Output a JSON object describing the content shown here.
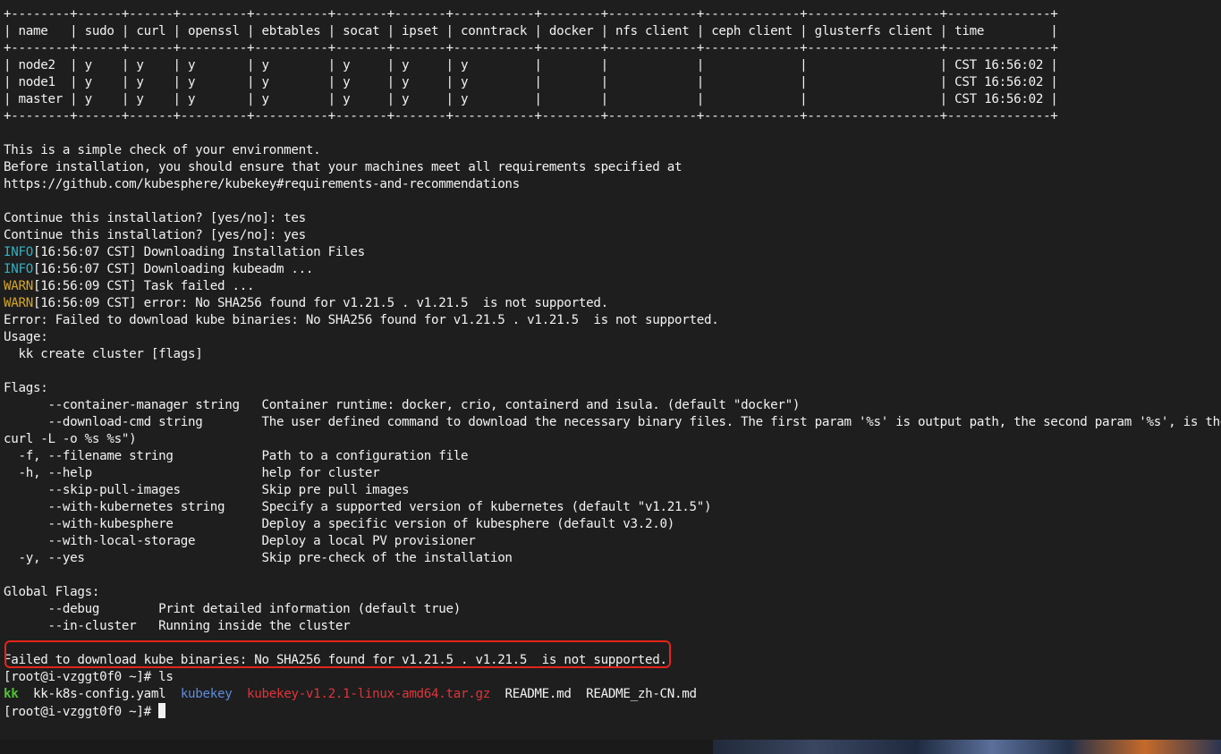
{
  "terminal": {
    "lines": [
      "+--------+------+------+---------+----------+-------+-------+-----------+--------+------------+-------------+------------------+--------------+",
      "| name   | sudo | curl | openssl | ebtables | socat | ipset | conntrack | docker | nfs client | ceph client | glusterfs client | time         |",
      "+--------+------+------+---------+----------+-------+-------+-----------+--------+------------+-------------+------------------+--------------+",
      "| node2  | y    | y    | y       | y        | y     | y     | y         |        |            |             |                  | CST 16:56:02 |",
      "| node1  | y    | y    | y       | y        | y     | y     | y         |        |            |             |                  | CST 16:56:02 |",
      "| master | y    | y    | y       | y        | y     | y     | y         |        |            |             |                  | CST 16:56:02 |",
      "+--------+------+------+---------+----------+-------+-------+-----------+--------+------------+-------------+------------------+--------------+",
      "",
      "This is a simple check of your environment.",
      "Before installation, you should ensure that your machines meet all requirements specified at",
      "https://github.com/kubesphere/kubekey#requirements-and-recommendations",
      "",
      "Continue this installation? [yes/no]: tes",
      "Continue this installation? [yes/no]: yes"
    ],
    "log_lines": [
      {
        "level": "INFO",
        "rest": "[16:56:07 CST] Downloading Installation Files"
      },
      {
        "level": "INFO",
        "rest": "[16:56:07 CST] Downloading kubeadm ..."
      },
      {
        "level": "WARN",
        "rest": "[16:56:09 CST] Task failed ..."
      },
      {
        "level": "WARN",
        "rest": "[16:56:09 CST] error: No SHA256 found for v1.21.5 . v1.21.5  is not supported."
      }
    ],
    "lines_after_log": [
      "Error: Failed to download kube binaries: No SHA256 found for v1.21.5 . v1.21.5  is not supported.",
      "Usage:",
      "  kk create cluster [flags]",
      "",
      "Flags:",
      "      --container-manager string   Container runtime: docker, crio, containerd and isula. (default \"docker\")",
      "      --download-cmd string        The user defined command to download the necessary binary files. The first param '%s' is output path, the second param '%s', is the URL",
      "curl -L -o %s %s\")",
      "  -f, --filename string            Path to a configuration file",
      "  -h, --help                       help for cluster",
      "      --skip-pull-images           Skip pre pull images",
      "      --with-kubernetes string     Specify a supported version of kubernetes (default \"v1.21.5\")",
      "      --with-kubesphere            Deploy a specific version of kubesphere (default v3.2.0)",
      "      --with-local-storage         Deploy a local PV provisioner",
      "  -y, --yes                        Skip pre-check of the installation",
      "",
      "Global Flags:",
      "      --debug        Print detailed information (default true)",
      "      --in-cluster   Running inside the cluster",
      "",
      "Failed to download kube binaries: No SHA256 found for v1.21.5 . v1.21.5  is not supported."
    ],
    "prompt": "[root@i-vzggt0f0 ~]# ",
    "ls_command": "ls",
    "ls_output": [
      {
        "name": "kk",
        "kind": "executable"
      },
      {
        "name": "kk-k8s-config.yaml",
        "kind": "file"
      },
      {
        "name": "kubekey",
        "kind": "directory"
      },
      {
        "name": "kubekey-v1.2.1-linux-amd64.tar.gz",
        "kind": "archive"
      },
      {
        "name": "README.md",
        "kind": "file"
      },
      {
        "name": "README_zh-CN.md",
        "kind": "file"
      }
    ],
    "colors": {
      "background": "#1e1e1e",
      "text": "#f2f2f2",
      "info": "#33b1c2",
      "warn": "#d6a626",
      "executable": "#51c237",
      "directory": "#5f8cdb",
      "archive": "#e0343a",
      "highlight_box": "#e5241a"
    }
  }
}
